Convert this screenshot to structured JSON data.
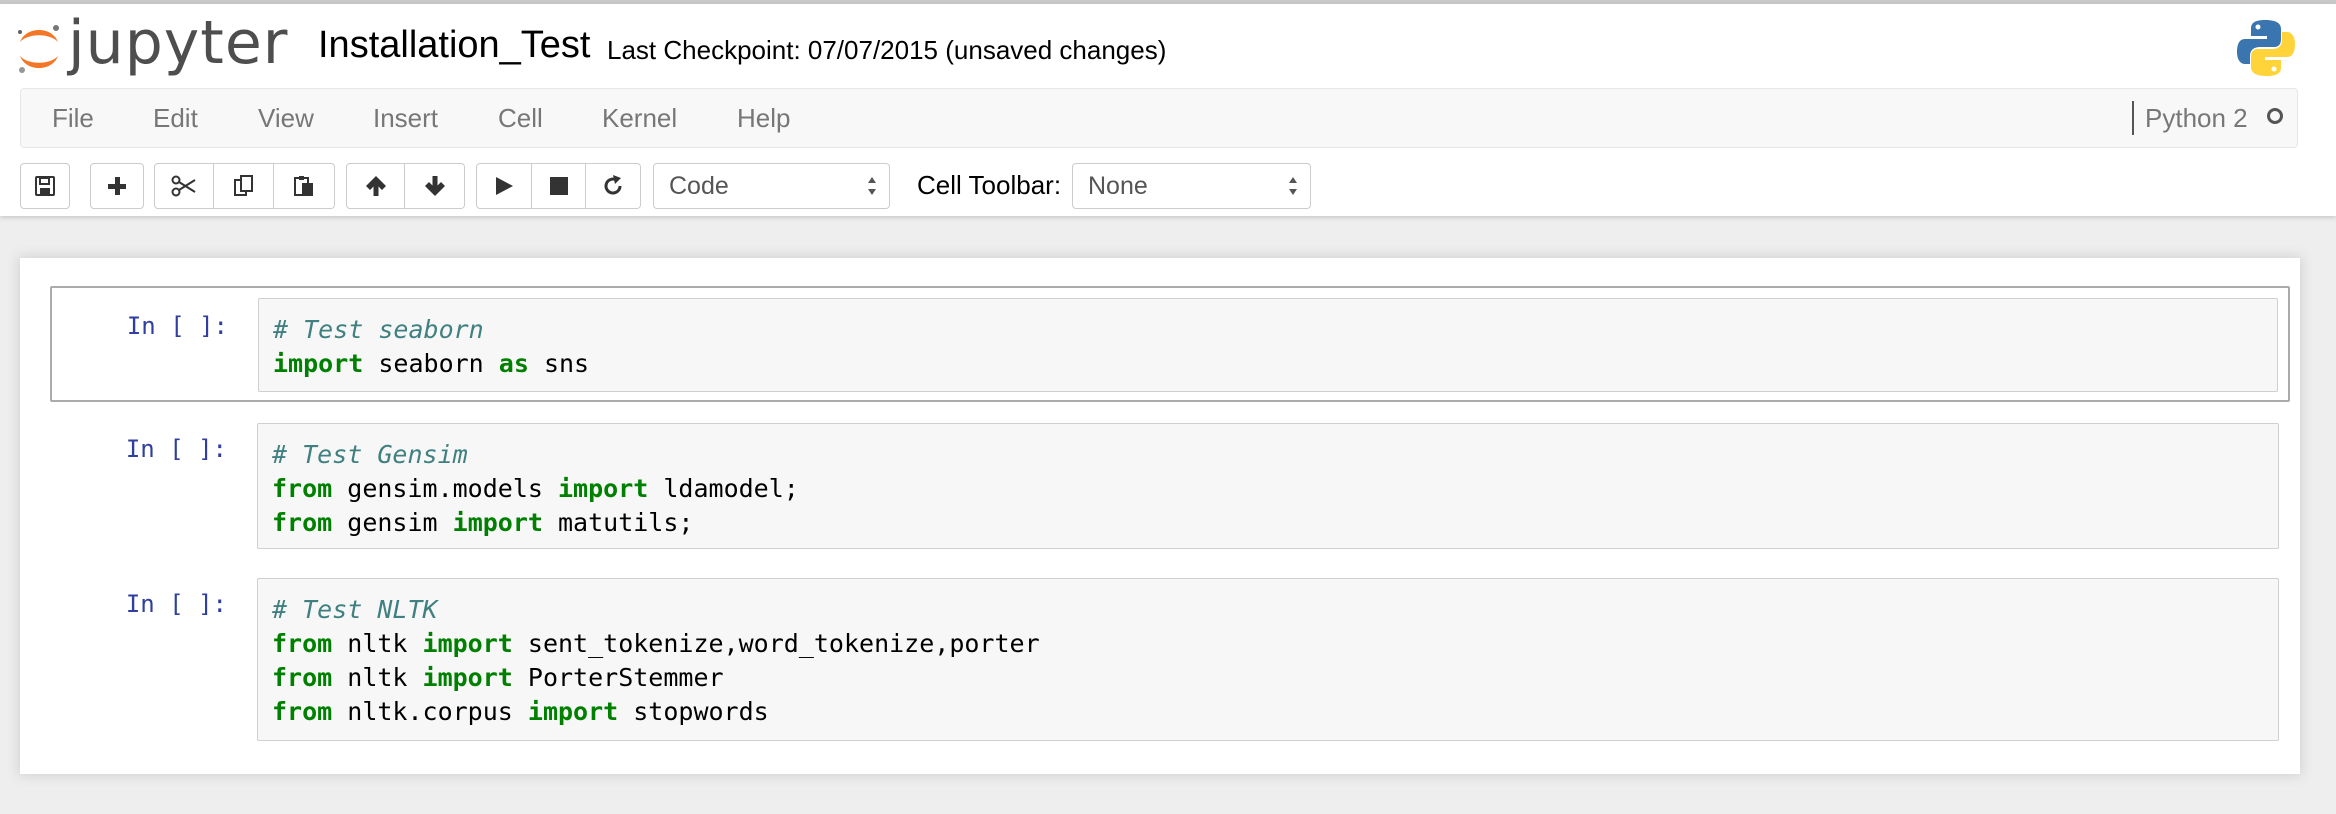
{
  "header": {
    "logo_text": "jupyter",
    "notebook_name": "Installation_Test",
    "checkpoint": "Last Checkpoint: 07/07/2015 (unsaved changes)"
  },
  "menu": {
    "items": [
      "File",
      "Edit",
      "View",
      "Insert",
      "Cell",
      "Kernel",
      "Help"
    ],
    "kernel_name": "Python 2"
  },
  "toolbar": {
    "buttons": [
      "save-icon",
      "plus-icon",
      "cut-icon",
      "copy-icon",
      "paste-icon",
      "arrow-up-icon",
      "arrow-down-icon",
      "play-icon",
      "stop-icon",
      "restart-icon"
    ],
    "cell_type": "Code",
    "cell_toolbar_label": "Cell Toolbar:",
    "cell_toolbar_value": "None"
  },
  "cells": [
    {
      "prompt": "In [ ]:",
      "lines": [
        [
          {
            "t": "# Test seaborn",
            "c": "comment"
          }
        ],
        [
          {
            "t": "import",
            "c": "keyword"
          },
          {
            "t": " seaborn ",
            "c": "plain"
          },
          {
            "t": "as",
            "c": "keyword"
          },
          {
            "t": " sns",
            "c": "plain"
          }
        ]
      ]
    },
    {
      "prompt": "In [ ]:",
      "lines": [
        [
          {
            "t": "# Test Gensim",
            "c": "comment"
          }
        ],
        [
          {
            "t": "from",
            "c": "keyword"
          },
          {
            "t": " gensim.models ",
            "c": "plain"
          },
          {
            "t": "import",
            "c": "keyword"
          },
          {
            "t": " ldamodel;",
            "c": "plain"
          }
        ],
        [
          {
            "t": "from",
            "c": "keyword"
          },
          {
            "t": " gensim ",
            "c": "plain"
          },
          {
            "t": "import",
            "c": "keyword"
          },
          {
            "t": " matutils;",
            "c": "plain"
          }
        ]
      ]
    },
    {
      "prompt": "In [ ]:",
      "lines": [
        [
          {
            "t": "# Test NLTK",
            "c": "comment"
          }
        ],
        [
          {
            "t": "from",
            "c": "keyword"
          },
          {
            "t": " nltk ",
            "c": "plain"
          },
          {
            "t": "import",
            "c": "keyword"
          },
          {
            "t": " sent_tokenize,word_tokenize,porter",
            "c": "plain"
          }
        ],
        [
          {
            "t": "from",
            "c": "keyword"
          },
          {
            "t": " nltk ",
            "c": "plain"
          },
          {
            "t": "import",
            "c": "keyword"
          },
          {
            "t": " PorterStemmer",
            "c": "plain"
          }
        ],
        [
          {
            "t": "from",
            "c": "keyword"
          },
          {
            "t": " nltk.corpus ",
            "c": "plain"
          },
          {
            "t": "import",
            "c": "keyword"
          },
          {
            "t": " stopwords",
            "c": "plain"
          }
        ]
      ]
    }
  ],
  "colors": {
    "keyword": "#008000",
    "comment": "#408080",
    "prompt": "#303f9f",
    "logo_orange": "#f37726"
  }
}
